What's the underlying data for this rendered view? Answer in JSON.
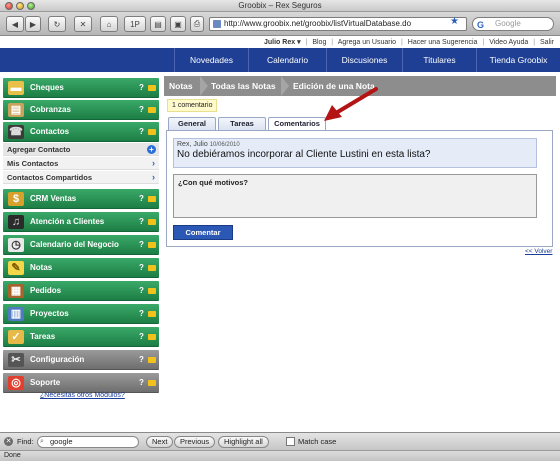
{
  "window": {
    "title": "Groobix – Rex Seguros"
  },
  "toolbar": {
    "url": "http://www.groobix.net/groobix/listVirtualDatabase.do",
    "search_placeholder": "Google",
    "reload_label": "1P"
  },
  "userbar": {
    "user": "Julio Rex ▾",
    "links": [
      "Blog",
      "Agrega un Usuario",
      "Hacer una Sugerencia",
      "Video Ayuda",
      "Salir"
    ]
  },
  "nav": {
    "items": [
      "Novedades",
      "Calendario",
      "Discusiones",
      "Titulares",
      "Tienda Groobix"
    ]
  },
  "sidebar": {
    "items": [
      {
        "label": "Cheques",
        "icon": "checks-icon"
      },
      {
        "label": "Cobranzas",
        "icon": "collections-icon"
      },
      {
        "label": "Contactos",
        "icon": "contacts-icon"
      },
      {
        "label": "CRM Ventas",
        "icon": "crm-icon"
      },
      {
        "label": "Atención a Clientes",
        "icon": "headset-icon"
      },
      {
        "label": "Calendario del Negocio",
        "icon": "clock-icon"
      },
      {
        "label": "Notas",
        "icon": "notes-icon"
      },
      {
        "label": "Pedidos",
        "icon": "box-icon"
      },
      {
        "label": "Proyectos",
        "icon": "projects-icon"
      },
      {
        "label": "Tareas",
        "icon": "tasks-icon"
      },
      {
        "label": "Configuración",
        "icon": "tools-icon"
      },
      {
        "label": "Soporte",
        "icon": "lifebuoy-icon"
      }
    ],
    "submenu": [
      "Agregar Contacto",
      "Mis Contactos",
      "Contactos Compartidos"
    ],
    "help": "?",
    "modules_link": "¿Necesitas otros Módulos?"
  },
  "breadcrumb": [
    "Notas",
    "Todas las Notas",
    "Edición de una Nota"
  ],
  "main": {
    "badge": "1 comentario",
    "tabs": [
      "General",
      "Tareas",
      "Comentarios"
    ],
    "comment": {
      "author": "Rex, Julio",
      "date": "10/06/2010",
      "text": "No debiéramos incorporar al Cliente Lustini en esta lista?"
    },
    "reply": "¿Con qué motivos?",
    "submit": "Comentar",
    "back": "<< Volver"
  },
  "findbar": {
    "label": "Find:",
    "query": "google",
    "next": "Next",
    "previous": "Previous",
    "highlight": "Highlight all",
    "match_case": "Match case"
  },
  "status": {
    "text": "Done"
  },
  "colors": {
    "nav": "#1f3f94",
    "menu_green": "#2a9355",
    "menu_gray": "#7e7e7e",
    "annotation_arrow": "#b51414"
  }
}
